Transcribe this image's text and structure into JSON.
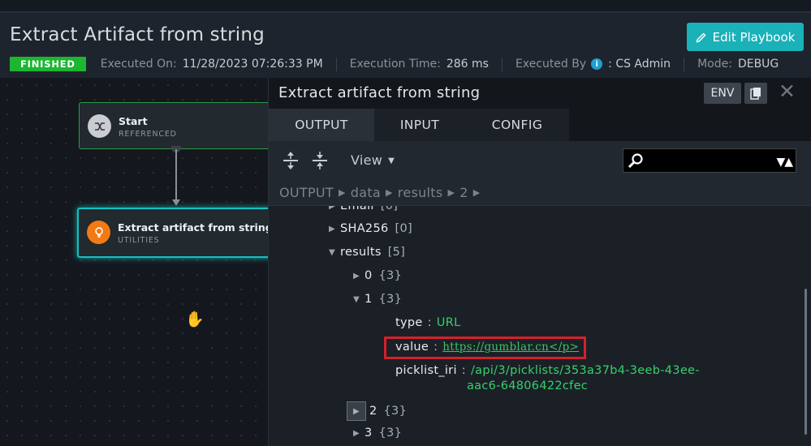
{
  "header": {
    "title": "Extract Artifact from string",
    "edit_button": "Edit Playbook",
    "status_badge": "FINISHED",
    "executed_on_label": "Executed On:",
    "executed_on_value": "11/28/2023 07:26:33 PM",
    "execution_time_label": "Execution Time:",
    "execution_time_value": "286 ms",
    "executed_by_label": "Executed By",
    "executed_by_value": ": CS Admin",
    "mode_label": "Mode:",
    "mode_value": "DEBUG"
  },
  "canvas": {
    "start_node": {
      "name": "Start",
      "sub": "REFERENCED",
      "icon": "shuffle-icon"
    },
    "extract_node": {
      "name": "Extract artifact from string",
      "sub": "UTILITIES",
      "icon": "lightbulb-icon"
    }
  },
  "panel": {
    "title": "Extract artifact from string",
    "env_button": "ENV",
    "tabs": [
      "OUTPUT",
      "INPUT",
      "CONFIG"
    ],
    "view_label": "View",
    "breadcrumb": [
      "OUTPUT",
      "data",
      "results",
      "2"
    ],
    "tree": {
      "email": {
        "key": "Email",
        "count": "[0]"
      },
      "sha256": {
        "key": "SHA256",
        "count": "[0]"
      },
      "results": {
        "key": "results",
        "count": "[5]"
      },
      "r0": {
        "key": "0",
        "count": "{3}"
      },
      "r1": {
        "key": "1",
        "count": "{3}"
      },
      "type": {
        "key": "type",
        "value": "URL"
      },
      "value": {
        "key": "value",
        "value": "https://gumblar.cn</p>"
      },
      "picklist": {
        "key": "picklist_iri",
        "value_line1": "/api/3/picklists/353a37b4-3eeb-43ee-",
        "value_line2": "aac6-64806422cfec"
      },
      "r2": {
        "key": "2",
        "count": "{3}"
      },
      "r3": {
        "key": "3",
        "count": "{3}"
      }
    }
  },
  "colors": {
    "accent": "#1ab1b8",
    "success": "#1cb631",
    "highlight": "#d6202a",
    "node_orange": "#f27a15"
  }
}
